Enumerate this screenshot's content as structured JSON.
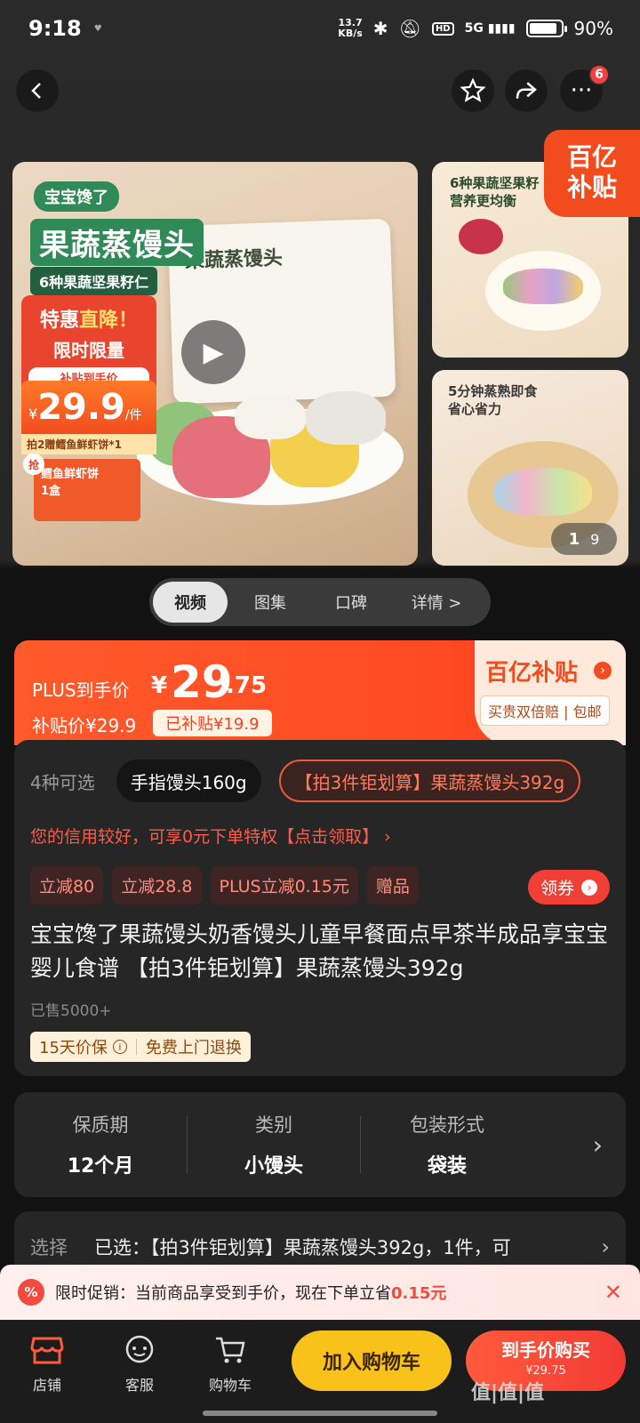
{
  "status_bar": {
    "time": "9:18",
    "net_speed_value": "13.7",
    "net_speed_unit": "KB/s",
    "signal": "5G",
    "battery": "90%",
    "battery_level": 0.9
  },
  "nav": {
    "more_badge": "6"
  },
  "media": {
    "main_image": {
      "brand": "宝宝馋了",
      "title": "果蔬蒸馒头",
      "subtitle": "6种果蔬坚果籽仁",
      "promo_line1_a": "特惠",
      "promo_line1_b": "直降！",
      "promo_line2": "限时限量",
      "promo_line3": "补贴到手价",
      "price_currency": "¥",
      "price_value": "29.9",
      "price_unit": "/件",
      "gift_line": "拍2赠鳕鱼鲜虾饼*1",
      "gift_tag": "抢",
      "gift_name": "鳕鱼鲜虾饼",
      "gift_qty": "1盒",
      "package_text": "果蔬蒸馒头"
    },
    "side_image_1": {
      "caption_line1": "6种果蔬坚果籽",
      "caption_line2": "营养更均衡"
    },
    "side_image_2": {
      "caption_line1": "5分钟蒸熟即食",
      "caption_line2": "省心省力"
    },
    "subsidy_badge_line1": "百亿",
    "subsidy_badge_line2": "补贴",
    "counter_current": "1",
    "counter_total": "9"
  },
  "tabs": [
    "视频",
    "图集",
    "口碑",
    "详情 >"
  ],
  "price_banner": {
    "plus_label": "PLUS到手价",
    "currency": "¥",
    "price_int": "29",
    "price_dec": ".75",
    "subsidy_price_label": "补贴价¥29.9",
    "subsidy_amount": "已补贴¥19.9",
    "logo": "百亿补贴",
    "tagline": "买贵双倍赔 | 包邮"
  },
  "info": {
    "variant_count": "4种可选",
    "variants": [
      "手指馒头160g",
      "【拍3件钜划算】果蔬蒸馒头392g"
    ],
    "credit_text": "您的信用较好，可享0元下单特权【点击领取】 ›",
    "coupons": [
      "立减80",
      "立减28.8",
      "PLUS立减0.15元",
      "赠品"
    ],
    "get_coupon": "领券",
    "title": "宝宝馋了果蔬馒头奶香馒头儿童早餐面点早茶半成品享宝宝婴儿食谱 【拍3件钜划算】果蔬蒸馒头392g",
    "sold": "已售5000+",
    "guarantee_1": "15天价保",
    "guarantee_2": "免费上门退换"
  },
  "specs": [
    {
      "key": "保质期",
      "value": "12个月"
    },
    {
      "key": "类别",
      "value": "小馒头"
    },
    {
      "key": "包装形式",
      "value": "袋装"
    }
  ],
  "select_row": {
    "label": "选择",
    "value": "已选：【拍3件钜划算】果蔬蒸馒头392g，1件，可"
  },
  "promo_toast": {
    "icon": "%",
    "text": "限时促销：当前商品享受到手价，现在下单立省",
    "amount": "0.15元"
  },
  "bottom_bar": {
    "store": "店铺",
    "service": "客服",
    "cart": "购物车",
    "add_to_cart": "加入购物车",
    "buy_now": "到手价购买",
    "buy_sub": "¥29.75"
  },
  "watermark": "值|值|值"
}
